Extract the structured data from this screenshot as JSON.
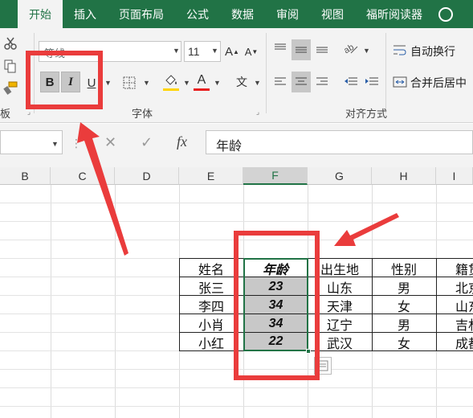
{
  "tabs": [
    "开始",
    "插入",
    "页面布局",
    "公式",
    "数据",
    "审阅",
    "视图",
    "福昕阅读器"
  ],
  "ribbon": {
    "font_name": "等线",
    "font_size": "11",
    "grow_font_icon": "A",
    "shrink_font_icon": "A",
    "bold_label": "B",
    "italic_label": "I",
    "underline_label": "U",
    "font_color_label": "A",
    "phonetic_label": "文",
    "wrap_text_label": "自动换行",
    "merge_center_label": "合并后居中",
    "font_group_label": "字体",
    "align_group_label": "对齐方式",
    "clipboard_partial_label": "板",
    "colors": {
      "accent": "#217346",
      "highlight": "#ffd400",
      "font_color": "#e81f1f",
      "annotation": "#ea3c3c"
    }
  },
  "formula_bar": {
    "cancel_icon": "✕",
    "enter_icon": "✓",
    "fx_label": "fx",
    "value": "年龄"
  },
  "columns": [
    "B",
    "C",
    "D",
    "E",
    "F",
    "G",
    "H",
    "I"
  ],
  "table": {
    "headers": [
      "姓名",
      "年龄",
      "出生地",
      "性别",
      "籍贯"
    ],
    "rows": [
      [
        "张三",
        "23",
        "山东",
        "男",
        "北京"
      ],
      [
        "李四",
        "34",
        "天津",
        "女",
        "山东"
      ],
      [
        "小肖",
        "34",
        "辽宁",
        "男",
        "吉林"
      ],
      [
        "小红",
        "22",
        "武汉",
        "女",
        "成都"
      ]
    ]
  }
}
